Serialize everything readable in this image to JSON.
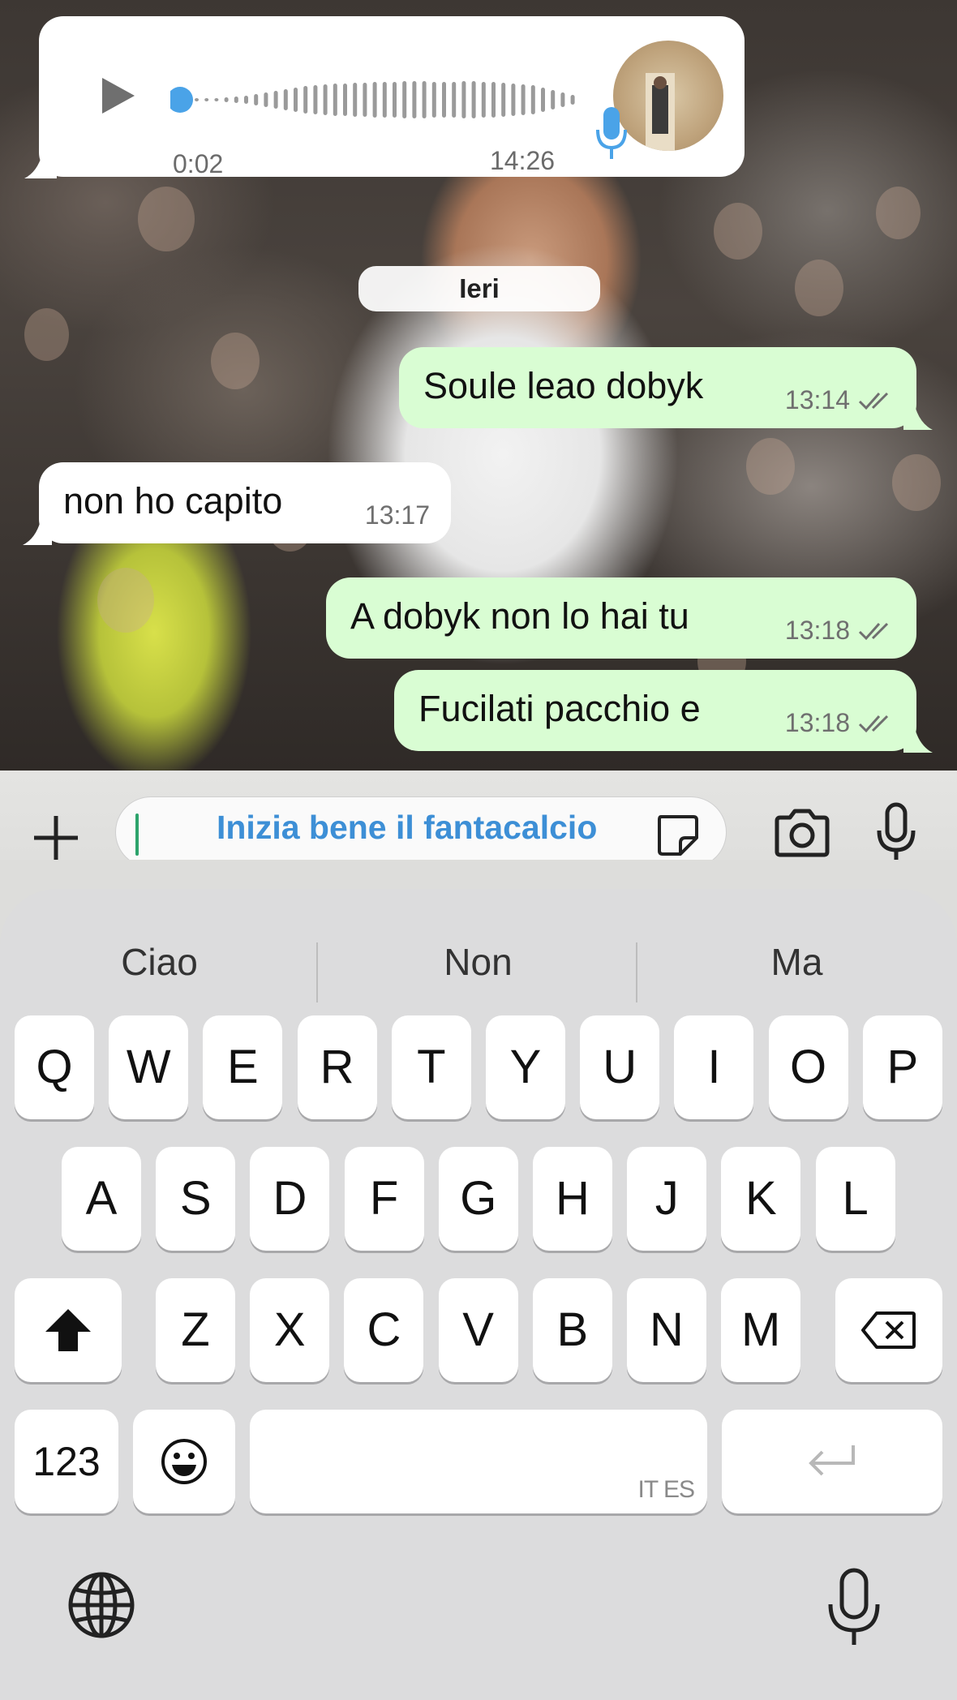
{
  "audio_message": {
    "elapsed": "0:02",
    "time": "14:26",
    "progress": 0.0
  },
  "date_separator": "Ieri",
  "messages": [
    {
      "direction": "out",
      "text": "Soule leao dobyk",
      "time": "13:14",
      "status": "read"
    },
    {
      "direction": "in",
      "text": "non ho capito",
      "time": "13:17"
    },
    {
      "direction": "out",
      "text": "A dobyk non lo hai tu",
      "time": "13:18",
      "status": "read"
    },
    {
      "direction": "out",
      "text": "Fucilati pacchio e",
      "time": "13:18",
      "status": "read"
    }
  ],
  "composer": {
    "input_value": "Inizia bene il fantacalcio",
    "icons": [
      "plus-icon",
      "sticker-icon",
      "camera-icon",
      "microphone-icon"
    ]
  },
  "keyboard": {
    "suggestions": [
      "Ciao",
      "Non",
      "Ma"
    ],
    "row1": [
      "Q",
      "W",
      "E",
      "R",
      "T",
      "Y",
      "U",
      "I",
      "O",
      "P"
    ],
    "row2": [
      "A",
      "S",
      "D",
      "F",
      "G",
      "H",
      "J",
      "K",
      "L"
    ],
    "row3": [
      "Z",
      "X",
      "C",
      "V",
      "B",
      "N",
      "M"
    ],
    "numbers_label": "123",
    "space_languages": "IT ES",
    "icons": [
      "shift-icon",
      "backspace-icon",
      "emoji-icon",
      "return-icon",
      "globe-icon",
      "dictation-mic-icon"
    ]
  },
  "colors": {
    "outgoing_bubble": "#d9fdd3",
    "incoming_bubble": "#ffffff",
    "accent_blue": "#3d8fd6",
    "ticks": "#53bdeb",
    "cursor": "#2ca36b"
  }
}
